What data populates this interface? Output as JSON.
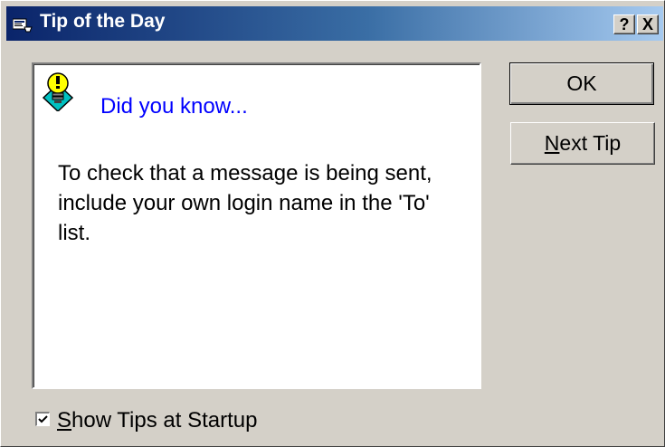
{
  "window": {
    "title": "Tip of the Day",
    "help_button": "?",
    "close_button": "X"
  },
  "tip": {
    "heading": "Did you know...",
    "text": "To check that a message is being sent, include your own login name in the 'To' list."
  },
  "buttons": {
    "ok_label": "OK",
    "next_tip_mnemonic": "N",
    "next_tip_rest": "ext Tip"
  },
  "startup_option": {
    "checked": true,
    "mnemonic": "S",
    "label_rest": "how Tips at Startup"
  },
  "colors": {
    "title_gradient_start": "#0a246a",
    "title_gradient_end": "#a6caf0",
    "heading_text": "#0000ff",
    "dialog_face": "#d4d0c8",
    "bulb_fill": "#ffff00",
    "diamond_fill": "#00c0c0"
  },
  "icons": [
    "app-icon",
    "lightbulb-icon",
    "checkmark-icon"
  ]
}
